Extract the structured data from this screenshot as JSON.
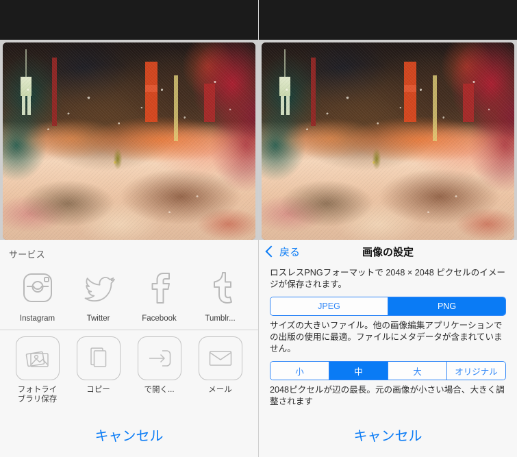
{
  "left_screen": {
    "photo": {
      "alt_name": "watercolor-bar-interior-photo"
    },
    "share_sheet": {
      "section_title": "サービス",
      "services": [
        {
          "label": "Instagram",
          "icon": "instagram-icon"
        },
        {
          "label": "Twitter",
          "icon": "twitter-icon"
        },
        {
          "label": "Facebook",
          "icon": "facebook-icon"
        },
        {
          "label": "Tumblr...",
          "icon": "tumblr-icon"
        }
      ],
      "actions": [
        {
          "label": "フォトライ\nブラリ保存",
          "icon": "photo-library-icon"
        },
        {
          "label": "コピー",
          "icon": "copy-icon"
        },
        {
          "label": "で開く...",
          "icon": "open-in-icon"
        },
        {
          "label": "メール",
          "icon": "mail-icon"
        },
        {
          "label": "",
          "icon": "more-icon"
        }
      ],
      "cancel_label": "キャンセル"
    }
  },
  "right_screen": {
    "photo": {
      "alt_name": "watercolor-bar-interior-photo"
    },
    "settings": {
      "back_label": "戻る",
      "title": "画像の設定",
      "format_description": "ロスレスPNGフォーマットで 2048 × 2048 ピクセルのイメージが保存されます。",
      "format_options": [
        {
          "label": "JPEG",
          "selected": false
        },
        {
          "label": "PNG",
          "selected": true
        }
      ],
      "format_note": "サイズの大きいファイル。他の画像編集アプリケーションでの出版の使用に最適。ファイルにメタデータが含まれていません。",
      "size_options": [
        {
          "label": "小",
          "selected": false
        },
        {
          "label": "中",
          "selected": true
        },
        {
          "label": "大",
          "selected": false
        },
        {
          "label": "オリジナル",
          "selected": false
        }
      ],
      "size_note": "2048ピクセルが辺の最長。元の画像が小さい場合、大きく調整されます",
      "cancel_label": "キャンセル"
    },
    "colors": {
      "accent_blue": "#0a7bf5",
      "segment_border": "#2f86f7",
      "sheet_background": "#f7f7f7",
      "topbar": "#1b1b1b"
    }
  }
}
